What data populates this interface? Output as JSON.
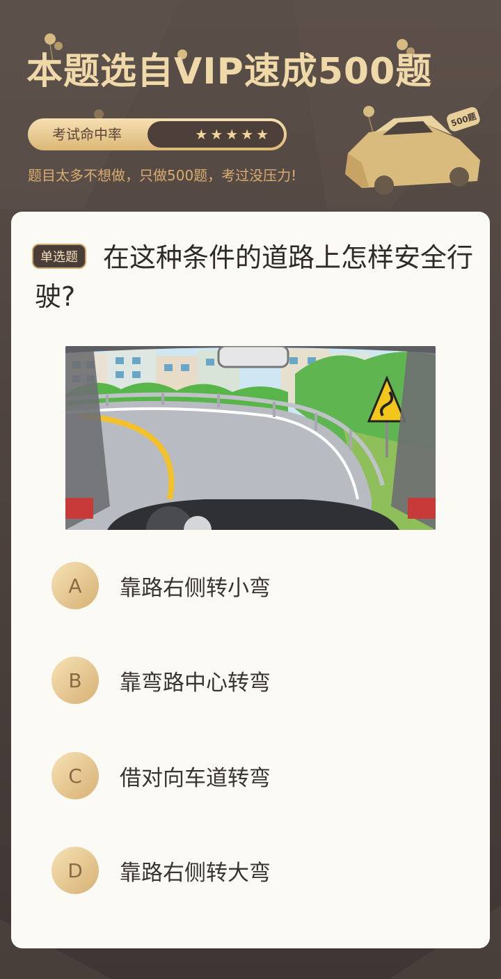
{
  "header": {
    "title": "本题选自VIP速成500题",
    "hit_rate_label": "考试命中率",
    "stars": [
      "★",
      "★",
      "★",
      "★",
      "★"
    ],
    "subtitle": "题目太多不想做，只做500题，考过没压力!",
    "badge_text": "500题"
  },
  "question": {
    "type_badge": "单选题",
    "text": "在这种条件的道路上怎样安全行驶?",
    "image_icon": "road-curve-driver-view-image"
  },
  "options": [
    {
      "letter": "A",
      "text": "靠路右侧转小弯"
    },
    {
      "letter": "B",
      "text": "靠弯路中心转弯"
    },
    {
      "letter": "C",
      "text": "借对向车道转弯"
    },
    {
      "letter": "D",
      "text": "靠路右侧转大弯"
    }
  ],
  "colors": {
    "background": "#4e4440",
    "gold": "#f0d9a9",
    "card": "#fcfaf5",
    "option_badge": "#e7c890"
  }
}
